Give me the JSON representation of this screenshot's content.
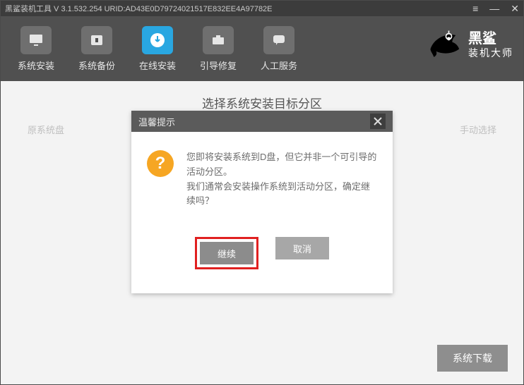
{
  "window": {
    "title": "黑鲨装机工具 V 3.1.532.254 URID:AD43E0D79724021517E832EE4A97782E"
  },
  "brand": {
    "line1": "黑鲨",
    "line2": "装机大师"
  },
  "toolbar": [
    {
      "label": "系统安装"
    },
    {
      "label": "系统备份"
    },
    {
      "label": "在线安装",
      "active": true
    },
    {
      "label": "引导修复"
    },
    {
      "label": "人工服务"
    }
  ],
  "page": {
    "heading": "选择系统安装目标分区",
    "hint_left": "原系统盘",
    "hint_right": "手动选择"
  },
  "modal": {
    "title": "温馨提示",
    "line1": "您即将安装系统到D盘，但它并非一个可引导的活动分区。",
    "line2": "我们通常会安装操作系统到活动分区，确定继续吗？",
    "continue": "继续",
    "cancel": "取消"
  },
  "footer": {
    "download": "系统下载"
  }
}
